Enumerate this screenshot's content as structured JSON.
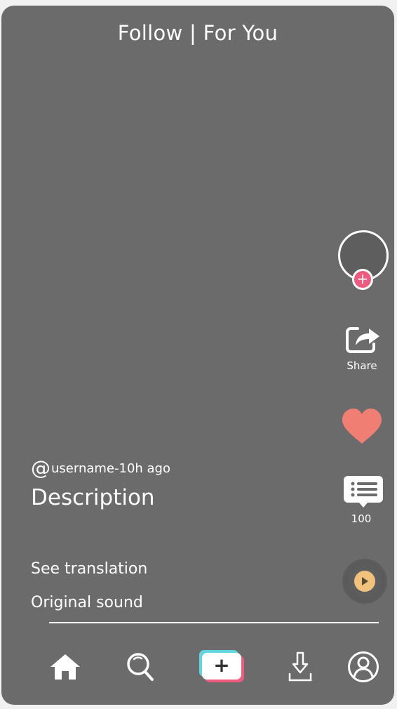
{
  "header": {
    "tabs_label": "Follow | For You"
  },
  "actions": {
    "share_label": "Share",
    "comment_count": "100",
    "follow_plus": "+"
  },
  "post": {
    "at_symbol": "@",
    "username_time": "username-10h ago",
    "description": "Description",
    "see_translation": "See translation",
    "original_sound": "Original sound"
  },
  "nav": {
    "create_plus": "+",
    "icons": [
      "home-icon",
      "search-icon",
      "create-icon",
      "download-icon",
      "profile-icon"
    ]
  },
  "colors": {
    "background": "#6b6b6b",
    "like": "#f07e72",
    "follow_badge": "#ef5a7f",
    "create_cyan": "#61d6e0",
    "create_pink": "#ef5a7f",
    "sound_disc_center": "#f0c27b"
  }
}
